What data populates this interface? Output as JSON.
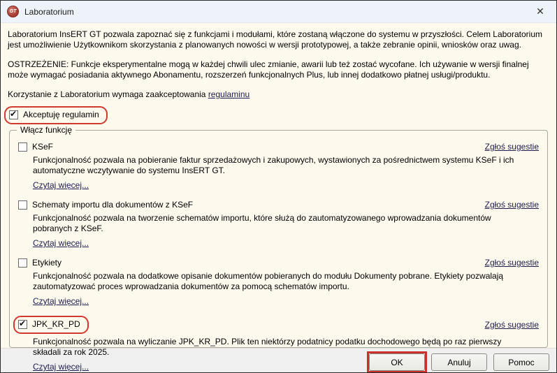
{
  "window": {
    "title": "Laboratorium",
    "close_glyph": "✕",
    "logo_text": "GT"
  },
  "intro": "Laboratorium InsERT GT pozwala zapoznać się z funkcjami i modułami, które zostaną włączone do systemu w przyszłości. Celem Laboratorium jest umożliwienie Użytkownikom skorzystania z planowanych nowości w wersji prototypowej, a także zebranie opinii, wniosków oraz uwag.",
  "warning": "OSTRZEŻENIE: Funkcje eksperymentalne mogą w każdej chwili ulec zmianie, awarii lub też zostać wycofane. Ich używanie w wersji finalnej może wymagać posiadania aktywnego Abonamentu, rozszerzeń funkcjonalnych Plus, lub innej dodatkowo płatnej usługi/produktu.",
  "consent": {
    "prefix": "Korzystanie z Laboratorium wymaga zaakceptowania ",
    "link": "regulaminu"
  },
  "accept_checkbox": {
    "label": "Akceptuję regulamin",
    "checked": true,
    "highlighted": true
  },
  "groupbox": {
    "title": "Włącz funkcję"
  },
  "features": [
    {
      "label": "KSeF",
      "checked": false,
      "highlighted": false,
      "suggest_link": "Zgłoś sugestie",
      "description": "Funkcjonalność pozwala na pobieranie faktur sprzedażowych i zakupowych, wystawionych za pośrednictwem systemu KSeF i ich automatyczne wczytywanie do systemu InsERT GT.",
      "read_more": "Czytaj więcej..."
    },
    {
      "label": "Schematy importu dla dokumentów z KSeF",
      "checked": false,
      "highlighted": false,
      "suggest_link": "Zgłoś sugestie",
      "description": "Funkcjonalność pozwala na tworzenie schematów importu, które służą do zautomatyzowanego wprowadzania dokumentów pobranych z KSeF.",
      "read_more": "Czytaj więcej..."
    },
    {
      "label": "Etykiety",
      "checked": false,
      "highlighted": false,
      "suggest_link": "Zgłoś sugestie",
      "description": "Funkcjonalność pozwala na dodatkowe opisanie dokumentów pobieranych do modułu Dokumenty pobrane. Etykiety pozwalają zautomatyzować proces wprowadzania dokumentów za pomocą schematów importu.",
      "read_more": "Czytaj więcej..."
    },
    {
      "label": "JPK_KR_PD",
      "checked": true,
      "highlighted": true,
      "suggest_link": "Zgłoś sugestie",
      "description": "Funkcjonalność pozwala na wyliczanie JPK_KR_PD. Plik ten niektórzy podatnicy podatku dochodowego będą po raz pierwszy składali za rok 2025.",
      "read_more": "Czytaj więcej..."
    }
  ],
  "buttons": {
    "ok": "OK",
    "ok_highlighted": true,
    "cancel": "Anuluj",
    "help": "Pomoc"
  },
  "colors": {
    "dialog_bg": "#fdf9ec",
    "titlebar_bg": "#eef3f9",
    "footer_bg": "#f0f0f0",
    "annotation_red": "#d23a31",
    "link": "#1e1e50"
  }
}
